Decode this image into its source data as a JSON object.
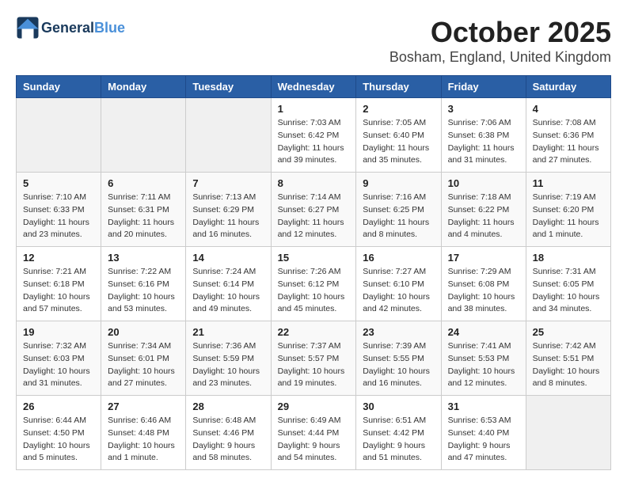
{
  "header": {
    "logo_line1": "General",
    "logo_line2": "Blue",
    "month_title": "October 2025",
    "location": "Bosham, England, United Kingdom"
  },
  "weekdays": [
    "Sunday",
    "Monday",
    "Tuesday",
    "Wednesday",
    "Thursday",
    "Friday",
    "Saturday"
  ],
  "weeks": [
    [
      {
        "day": "",
        "info": ""
      },
      {
        "day": "",
        "info": ""
      },
      {
        "day": "",
        "info": ""
      },
      {
        "day": "1",
        "info": "Sunrise: 7:03 AM\nSunset: 6:42 PM\nDaylight: 11 hours\nand 39 minutes."
      },
      {
        "day": "2",
        "info": "Sunrise: 7:05 AM\nSunset: 6:40 PM\nDaylight: 11 hours\nand 35 minutes."
      },
      {
        "day": "3",
        "info": "Sunrise: 7:06 AM\nSunset: 6:38 PM\nDaylight: 11 hours\nand 31 minutes."
      },
      {
        "day": "4",
        "info": "Sunrise: 7:08 AM\nSunset: 6:36 PM\nDaylight: 11 hours\nand 27 minutes."
      }
    ],
    [
      {
        "day": "5",
        "info": "Sunrise: 7:10 AM\nSunset: 6:33 PM\nDaylight: 11 hours\nand 23 minutes."
      },
      {
        "day": "6",
        "info": "Sunrise: 7:11 AM\nSunset: 6:31 PM\nDaylight: 11 hours\nand 20 minutes."
      },
      {
        "day": "7",
        "info": "Sunrise: 7:13 AM\nSunset: 6:29 PM\nDaylight: 11 hours\nand 16 minutes."
      },
      {
        "day": "8",
        "info": "Sunrise: 7:14 AM\nSunset: 6:27 PM\nDaylight: 11 hours\nand 12 minutes."
      },
      {
        "day": "9",
        "info": "Sunrise: 7:16 AM\nSunset: 6:25 PM\nDaylight: 11 hours\nand 8 minutes."
      },
      {
        "day": "10",
        "info": "Sunrise: 7:18 AM\nSunset: 6:22 PM\nDaylight: 11 hours\nand 4 minutes."
      },
      {
        "day": "11",
        "info": "Sunrise: 7:19 AM\nSunset: 6:20 PM\nDaylight: 11 hours\nand 1 minute."
      }
    ],
    [
      {
        "day": "12",
        "info": "Sunrise: 7:21 AM\nSunset: 6:18 PM\nDaylight: 10 hours\nand 57 minutes."
      },
      {
        "day": "13",
        "info": "Sunrise: 7:22 AM\nSunset: 6:16 PM\nDaylight: 10 hours\nand 53 minutes."
      },
      {
        "day": "14",
        "info": "Sunrise: 7:24 AM\nSunset: 6:14 PM\nDaylight: 10 hours\nand 49 minutes."
      },
      {
        "day": "15",
        "info": "Sunrise: 7:26 AM\nSunset: 6:12 PM\nDaylight: 10 hours\nand 45 minutes."
      },
      {
        "day": "16",
        "info": "Sunrise: 7:27 AM\nSunset: 6:10 PM\nDaylight: 10 hours\nand 42 minutes."
      },
      {
        "day": "17",
        "info": "Sunrise: 7:29 AM\nSunset: 6:08 PM\nDaylight: 10 hours\nand 38 minutes."
      },
      {
        "day": "18",
        "info": "Sunrise: 7:31 AM\nSunset: 6:05 PM\nDaylight: 10 hours\nand 34 minutes."
      }
    ],
    [
      {
        "day": "19",
        "info": "Sunrise: 7:32 AM\nSunset: 6:03 PM\nDaylight: 10 hours\nand 31 minutes."
      },
      {
        "day": "20",
        "info": "Sunrise: 7:34 AM\nSunset: 6:01 PM\nDaylight: 10 hours\nand 27 minutes."
      },
      {
        "day": "21",
        "info": "Sunrise: 7:36 AM\nSunset: 5:59 PM\nDaylight: 10 hours\nand 23 minutes."
      },
      {
        "day": "22",
        "info": "Sunrise: 7:37 AM\nSunset: 5:57 PM\nDaylight: 10 hours\nand 19 minutes."
      },
      {
        "day": "23",
        "info": "Sunrise: 7:39 AM\nSunset: 5:55 PM\nDaylight: 10 hours\nand 16 minutes."
      },
      {
        "day": "24",
        "info": "Sunrise: 7:41 AM\nSunset: 5:53 PM\nDaylight: 10 hours\nand 12 minutes."
      },
      {
        "day": "25",
        "info": "Sunrise: 7:42 AM\nSunset: 5:51 PM\nDaylight: 10 hours\nand 8 minutes."
      }
    ],
    [
      {
        "day": "26",
        "info": "Sunrise: 6:44 AM\nSunset: 4:50 PM\nDaylight: 10 hours\nand 5 minutes."
      },
      {
        "day": "27",
        "info": "Sunrise: 6:46 AM\nSunset: 4:48 PM\nDaylight: 10 hours\nand 1 minute."
      },
      {
        "day": "28",
        "info": "Sunrise: 6:48 AM\nSunset: 4:46 PM\nDaylight: 9 hours\nand 58 minutes."
      },
      {
        "day": "29",
        "info": "Sunrise: 6:49 AM\nSunset: 4:44 PM\nDaylight: 9 hours\nand 54 minutes."
      },
      {
        "day": "30",
        "info": "Sunrise: 6:51 AM\nSunset: 4:42 PM\nDaylight: 9 hours\nand 51 minutes."
      },
      {
        "day": "31",
        "info": "Sunrise: 6:53 AM\nSunset: 4:40 PM\nDaylight: 9 hours\nand 47 minutes."
      },
      {
        "day": "",
        "info": ""
      }
    ]
  ]
}
